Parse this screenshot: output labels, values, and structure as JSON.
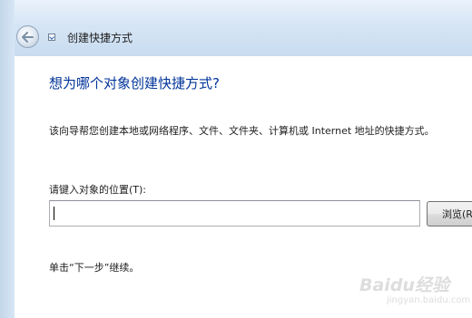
{
  "window": {
    "title": "创建快捷方式"
  },
  "wizard": {
    "heading": "想为哪个对象创建快捷方式?",
    "description": "该向导帮您创建本地或网络程序、文件、文件夹、计算机或 Internet 地址的快捷方式。",
    "location_label": "请键入对象的位置(T):",
    "location_value": "",
    "browse_label": "浏览(R)...",
    "hint": "单击“下一步”继续。"
  },
  "watermark": {
    "logo_text": "Baidu经验",
    "sub_text": "jingyan.baidu.com"
  },
  "icons": {
    "back": "back-arrow-icon",
    "app": "shortcut-app-icon"
  },
  "colors": {
    "heading": "#003399",
    "title_bar": "#d6e5f5",
    "content_bg": "#ffffff"
  }
}
